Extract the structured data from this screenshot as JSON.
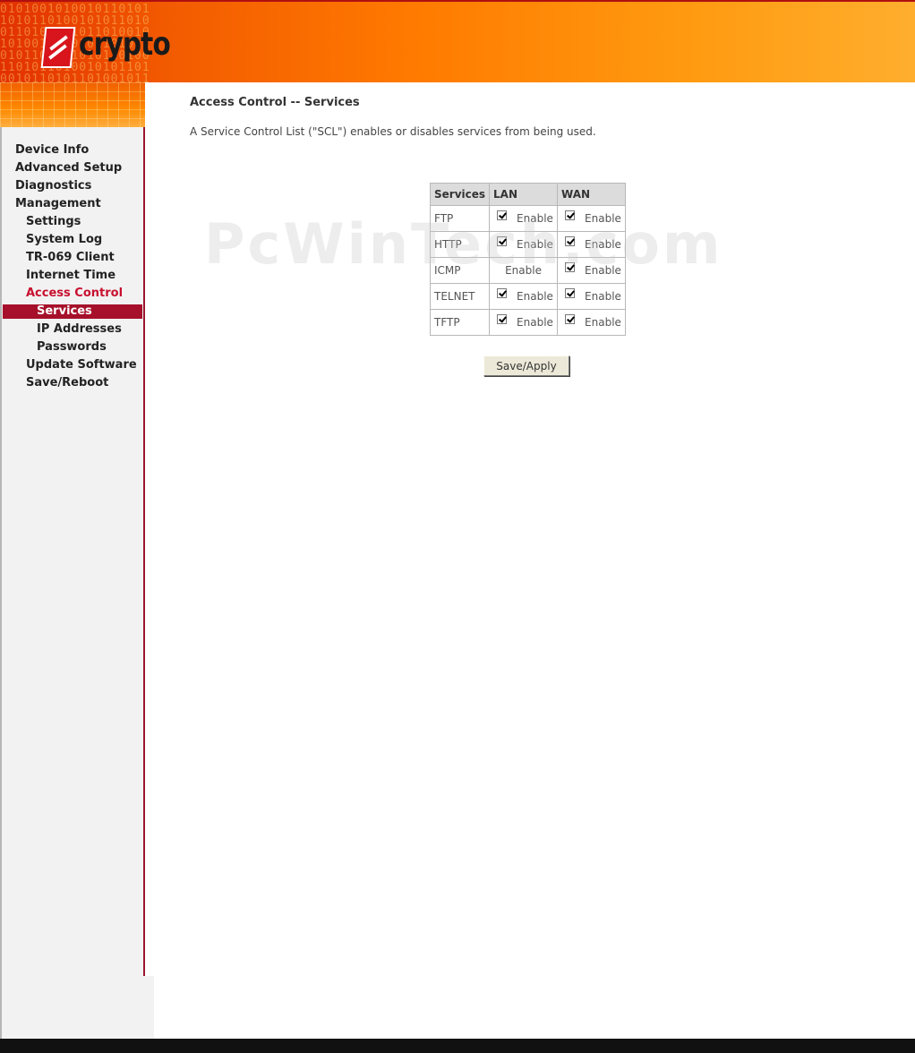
{
  "brand": {
    "logo_text": "crypto"
  },
  "sidebar": {
    "items": [
      {
        "label": "Device Info",
        "level": 0,
        "state": "normal"
      },
      {
        "label": "Advanced Setup",
        "level": 0,
        "state": "normal"
      },
      {
        "label": "Diagnostics",
        "level": 0,
        "state": "normal"
      },
      {
        "label": "Management",
        "level": 0,
        "state": "normal"
      },
      {
        "label": "Settings",
        "level": 1,
        "state": "normal"
      },
      {
        "label": "System Log",
        "level": 1,
        "state": "normal"
      },
      {
        "label": "TR-069 Client",
        "level": 1,
        "state": "normal"
      },
      {
        "label": "Internet Time",
        "level": 1,
        "state": "normal"
      },
      {
        "label": "Access Control",
        "level": 1,
        "state": "active-parent"
      },
      {
        "label": "Services",
        "level": 2,
        "state": "selected"
      },
      {
        "label": "IP Addresses",
        "level": 2,
        "state": "normal"
      },
      {
        "label": "Passwords",
        "level": 2,
        "state": "normal"
      },
      {
        "label": "Update Software",
        "level": 1,
        "state": "normal"
      },
      {
        "label": "Save/Reboot",
        "level": 1,
        "state": "normal"
      }
    ]
  },
  "main": {
    "title": "Access Control -- Services",
    "description": "A Service Control List (\"SCL\") enables or disables services from being used.",
    "watermark": "PcWinTech.com",
    "table": {
      "headers": {
        "services": "Services",
        "lan": "LAN",
        "wan": "WAN"
      },
      "enable_label": "Enable",
      "rows": [
        {
          "service": "FTP",
          "lan_checked": true,
          "lan_has_checkbox": true,
          "wan_checked": true
        },
        {
          "service": "HTTP",
          "lan_checked": true,
          "lan_has_checkbox": true,
          "wan_checked": true
        },
        {
          "service": "ICMP",
          "lan_checked": false,
          "lan_has_checkbox": false,
          "wan_checked": true
        },
        {
          "service": "TELNET",
          "lan_checked": true,
          "lan_has_checkbox": true,
          "wan_checked": true
        },
        {
          "service": "TFTP",
          "lan_checked": true,
          "lan_has_checkbox": true,
          "wan_checked": true
        }
      ]
    },
    "save_button_label": "Save/Apply"
  },
  "colors": {
    "header_orange": "#ff7a00",
    "selected_nav_bg": "#a6102a",
    "active_nav_text": "#c8102e"
  }
}
